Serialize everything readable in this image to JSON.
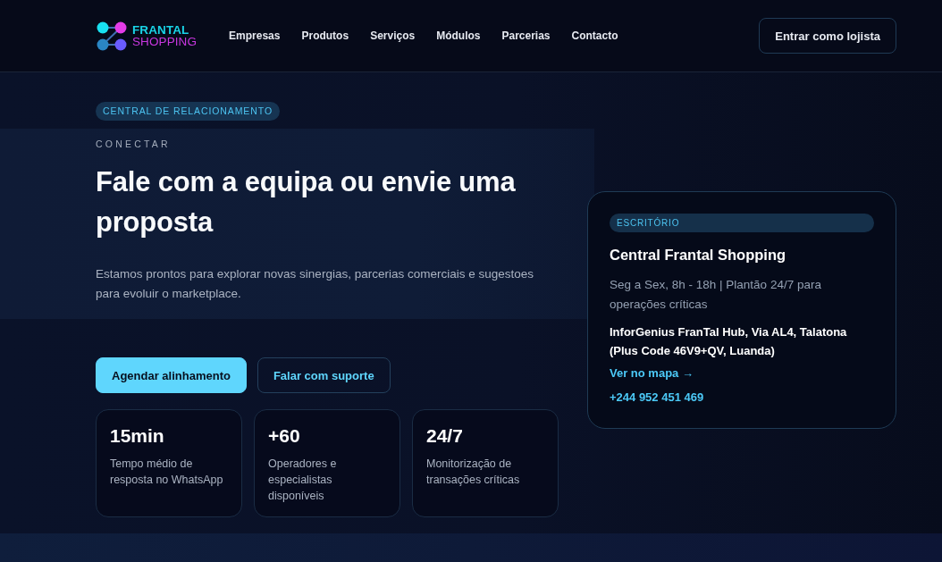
{
  "header": {
    "logo": {
      "line_1": "FRANTAL",
      "line_2": "SHOPPING"
    },
    "nav": [
      "Empresas",
      "Produtos",
      "Serviços",
      "Módulos",
      "Parcerias",
      "Contacto"
    ],
    "login_button": "Entrar como lojista"
  },
  "hero": {
    "badge": "CENTRAL DE RELACIONAMENTO",
    "eyebrow": "CONECTAR",
    "title": "Fale com a equipa ou envie uma proposta",
    "description": "Estamos prontos para explorar novas sinergias, parcerias comerciais e sugestoes para evoluir o marketplace.",
    "buttons": [
      {
        "label": "Agendar alinhamento",
        "kind": "primary"
      },
      {
        "label": "Falar com suporte",
        "kind": "secondary"
      }
    ],
    "stats": [
      {
        "value": "15min",
        "label": "Tempo médio de resposta no WhatsApp"
      },
      {
        "value": "+60",
        "label": "Operadores e especialistas disponíveis"
      },
      {
        "value": "24/7",
        "label": "Monitorização de transações críticas"
      }
    ]
  },
  "office_card": {
    "tag": "ESCRITÓRIO",
    "title": "Central Frantal Shopping",
    "hours": "Seg a Sex, 8h - 18h | Plantão 24/7 para operações críticas",
    "address": "InforGenius FranTal Hub, Via AL4, Talatona (Plus Code 46V9+QV, Luanda)",
    "map_link": "Ver no mapa →",
    "phone": "+244 952 451 469"
  }
}
